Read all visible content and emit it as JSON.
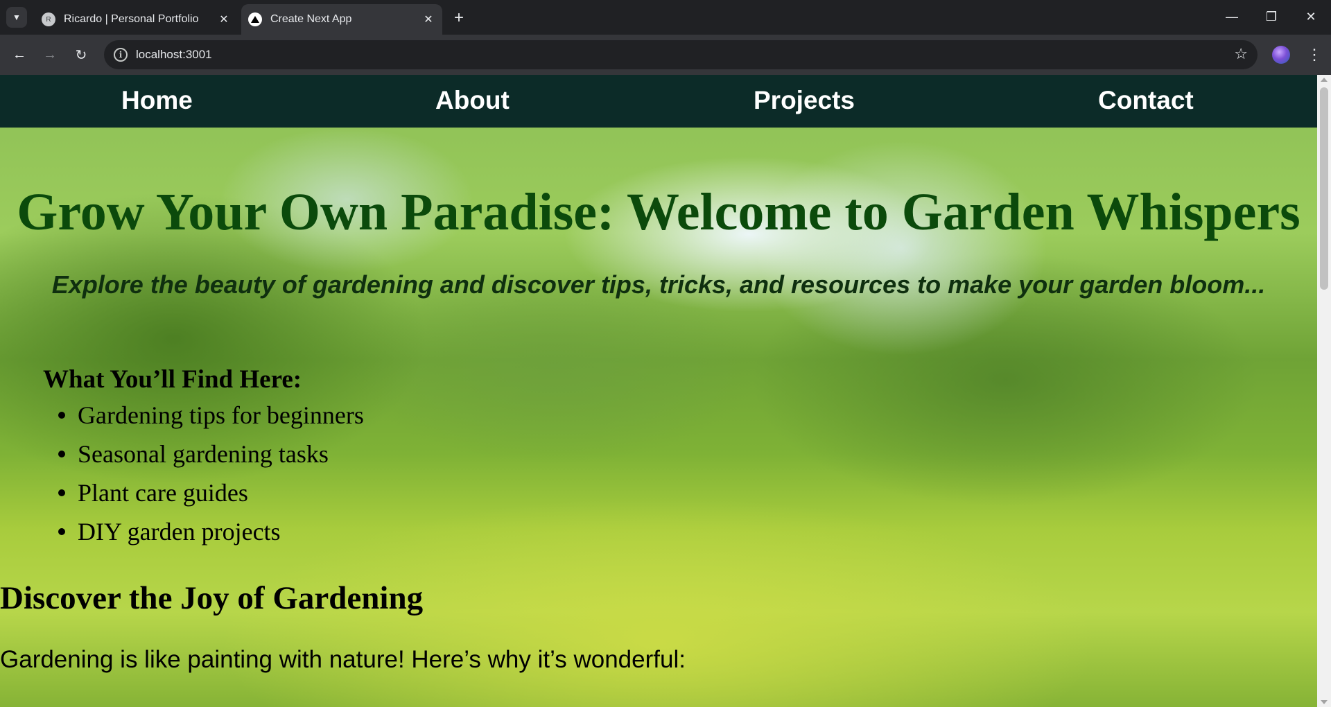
{
  "browser": {
    "tabs": [
      {
        "title": "Ricardo | Personal Portfolio",
        "favicon": "R",
        "active": false
      },
      {
        "title": "Create Next App",
        "favicon": "▲",
        "active": true
      }
    ],
    "url": "localhost:3001",
    "icons": {
      "tab_search": "chevron-down-icon",
      "new_tab": "plus-icon",
      "back": "arrow-left-icon",
      "forward": "arrow-right-icon",
      "reload": "reload-icon",
      "site_info": "info-icon",
      "bookmark": "star-icon",
      "menu": "kebab-menu-icon"
    }
  },
  "page": {
    "nav": [
      "Home",
      "About",
      "Projects",
      "Contact"
    ],
    "hero_title": "Grow Your Own Paradise: Welcome to Garden Whispers",
    "hero_subtitle": "Explore the beauty of gardening and discover tips, tricks, and resources to make your garden bloom...",
    "find_heading": "What You’ll Find Here:",
    "find_items": [
      "Gardening tips for beginners",
      "Seasonal gardening tasks",
      "Plant care guides",
      "DIY garden projects"
    ],
    "joy_heading": "Discover the Joy of Gardening",
    "joy_text": "Gardening is like painting with nature! Here’s why it’s wonderful:",
    "colors": {
      "navbar": "#0c2b28",
      "hero_title": "#0b4a0b",
      "hero_subtitle": "#0f2f0f"
    }
  }
}
